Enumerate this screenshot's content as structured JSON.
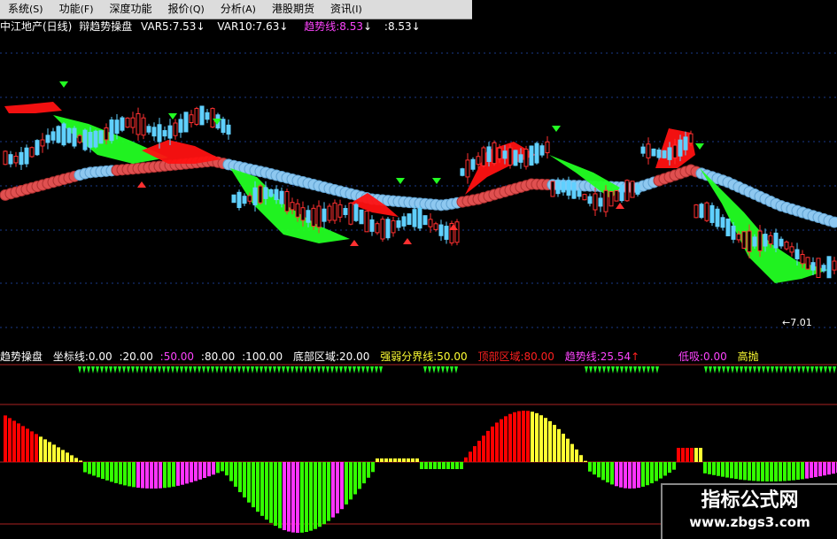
{
  "menu": [
    {
      "label": "系统",
      "hotkey": "(S)"
    },
    {
      "label": "功能",
      "hotkey": "(F)"
    },
    {
      "label": "深度功能",
      "hotkey": ""
    },
    {
      "label": "报价",
      "hotkey": "(Q)"
    },
    {
      "label": "分析",
      "hotkey": "(A)"
    },
    {
      "label": "港股期货",
      "hotkey": ""
    },
    {
      "label": "资讯",
      "hotkey": "(I)"
    }
  ],
  "main_chart": {
    "title": "中江地产(日线)",
    "formula": "辩趋势操盘",
    "var5_label": "VAR5:",
    "var5_value": "7.53",
    "var10_label": "VAR10:",
    "var10_value": "7.63",
    "trend_label": "趋势线:",
    "trend_value": "8.53",
    "extra_value": ":8.53",
    "low_price_label": "←7.01",
    "colors": {
      "text": "#ffffff",
      "trend": "#ff44ff",
      "up": "#ff2020",
      "down": "#00ff00",
      "line_red": "#ff5050",
      "line_blue": "#8ec8f0"
    }
  },
  "indicator": {
    "name": "趋势操盘",
    "axis_label": "坐标线:",
    "axis_v0": "0.00",
    "axis_v20": ":20.00",
    "axis_v50": ":50.00",
    "axis_v80": ":80.00",
    "axis_v100": ":100.00",
    "bottom_zone_label": "底部区域:",
    "bottom_zone_value": "20.00",
    "divider_label": "强弱分界线:",
    "divider_value": "50.00",
    "top_zone_label": "顶部区域:",
    "top_zone_value": "80.00",
    "trend_label": "趋势线:",
    "trend_value": "25.54",
    "low_buy_label": "低吸:",
    "low_buy_value": "0.00",
    "high_sell_label": "高抛",
    "colors": {
      "red": "#ff0000",
      "yellow": "#ffff33",
      "green": "#33ff00",
      "magenta": "#ff33ff"
    }
  },
  "watermark": {
    "title": "指标公式网",
    "url": "www.zbgs3.com"
  }
}
